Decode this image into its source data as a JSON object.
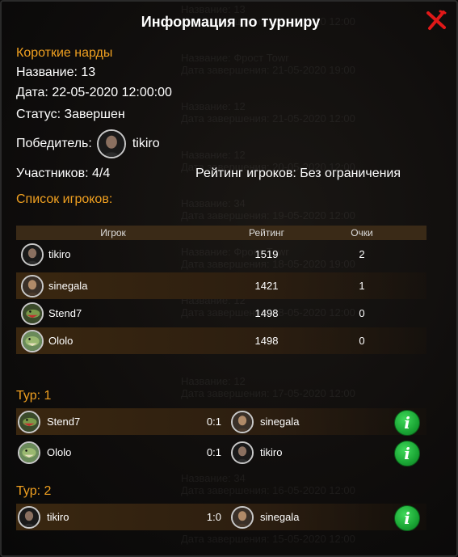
{
  "dialog": {
    "title": "Информация по турниру"
  },
  "tournament": {
    "type": "Короткие нарды",
    "name_line": "Название: 13",
    "date_line": "Дата: 22-05-2020 12:00:00",
    "status_line": "Статус: Завершен",
    "winner_label": "Победитель:",
    "winner_name": "tikiro",
    "participants_line": "Участников: 4/4",
    "rating_limit_line": "Рейтинг игроков: Без ограничения"
  },
  "players_section": {
    "heading": "Список игроков:",
    "columns": {
      "player": "Игрок",
      "rating": "Рейтинг",
      "points": "Очки"
    },
    "rows": [
      {
        "name": "tikiro",
        "rating": "1519",
        "points": "2",
        "avatar": "man-avatar"
      },
      {
        "name": "sinegala",
        "rating": "1421",
        "points": "1",
        "avatar": "man-avatar"
      },
      {
        "name": "Stend7",
        "rating": "1498",
        "points": "0",
        "avatar": "dinosaur-avatar"
      },
      {
        "name": "Ololo",
        "rating": "1498",
        "points": "0",
        "avatar": "dinosaur-avatar"
      }
    ]
  },
  "rounds": [
    {
      "label": "Тур: 1",
      "matches": [
        {
          "p1": "Stend7",
          "score": "0:1",
          "p2": "sinegala"
        },
        {
          "p1": "Ololo",
          "score": "0:1",
          "p2": "tikiro"
        }
      ]
    },
    {
      "label": "Тур: 2",
      "matches": [
        {
          "p1": "tikiro",
          "score": "1:0",
          "p2": "sinegala"
        }
      ]
    }
  ],
  "info_button_glyph": "i",
  "colors": {
    "accent": "#f0a020",
    "row_highlight": "#3a2710",
    "info_green": "#1aa534",
    "close_red": "#e01818"
  },
  "background": {
    "rows": [
      {
        "name": "Название: 13",
        "date": "Дата завершения: 22-05-2020 12:00"
      },
      {
        "name": "Название: Фрост Тоwr",
        "date": "Дата завершения: 21-05-2020 19:00"
      },
      {
        "name": "Название: 12",
        "date": "Дата завершения: 21-05-2020 12:00"
      },
      {
        "name": "Название: 12",
        "date": "Дата завершения: 20-05-2020 12:00"
      },
      {
        "name": "Название: 34",
        "date": "Дата завершения: 19-05-2020 12:00"
      },
      {
        "name": "Название: Фрост Тоwr",
        "date": "Дата завершения: 18-05-2020 19:00"
      },
      {
        "name": "Название: 12",
        "date": "Дата завершения: 18-05-2020 12:00"
      },
      {
        "name": "Название: 12",
        "date": "Дата завершения: 17-05-2020 12:00"
      },
      {
        "name": "Название: 34",
        "date": "Дата завершения: 16-05-2020 12:00"
      },
      {
        "name": "Название: 34",
        "date": "Дата завершения: 15-05-2020 12:00"
      }
    ]
  }
}
